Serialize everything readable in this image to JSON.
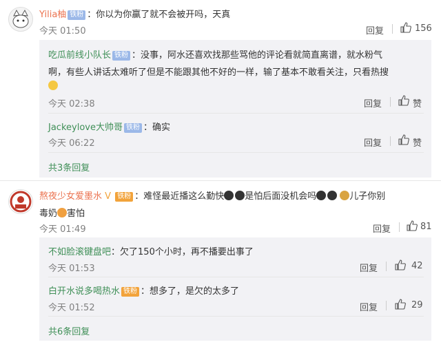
{
  "c1": {
    "user": "Yilia柚",
    "badge": "铁粉",
    "text": "你以为你赢了就不会被开吗，天真",
    "time": "今天 01:50",
    "reply": "回复",
    "likes": "156",
    "replies": [
      {
        "user": "吃瓜前线小队长",
        "badge": "铁粉",
        "text1": "没事，阿水还喜欢找那些骂他的评论看就简直离谱，就水粉气",
        "text2": "啊，有些人讲话太难听了但是不能跟其他不好的一样，输了基本不敢看关注，只看热搜",
        "time": "今天 02:38",
        "reply": "回复",
        "likes": "赞"
      },
      {
        "user": "Jackeylove大帅哥",
        "badge": "铁粉",
        "text": "确实",
        "time": "今天 06:22",
        "reply": "回复",
        "likes": "赞"
      }
    ],
    "more": "共3条回复"
  },
  "c2": {
    "user": "熬夜少女爱墨水",
    "badge": "铁粉",
    "text1a": "难怪最近播这么勤快",
    "text1b": "是怕后面没机会吗",
    "text1c": "儿子你别",
    "text2a": "毒奶",
    "text2b": "害怕",
    "time": "今天 01:49",
    "reply": "回复",
    "likes": "81",
    "replies": [
      {
        "user": "不如脸滚键盘吧",
        "text": "欠了150个小时，再不播要出事了",
        "time": "今天 01:53",
        "reply": "回复",
        "likes": "42"
      },
      {
        "user": "白开水说多喝热水",
        "badge": "铁粉",
        "text": "想多了，是欠的太多了",
        "time": "今天 01:52",
        "reply": "回复",
        "likes": "29"
      }
    ],
    "more": "共6条回复"
  },
  "colors": {
    "username": "#eb7350",
    "link_green": "#3f8f57",
    "sub_bg": "#f2f2f5"
  }
}
